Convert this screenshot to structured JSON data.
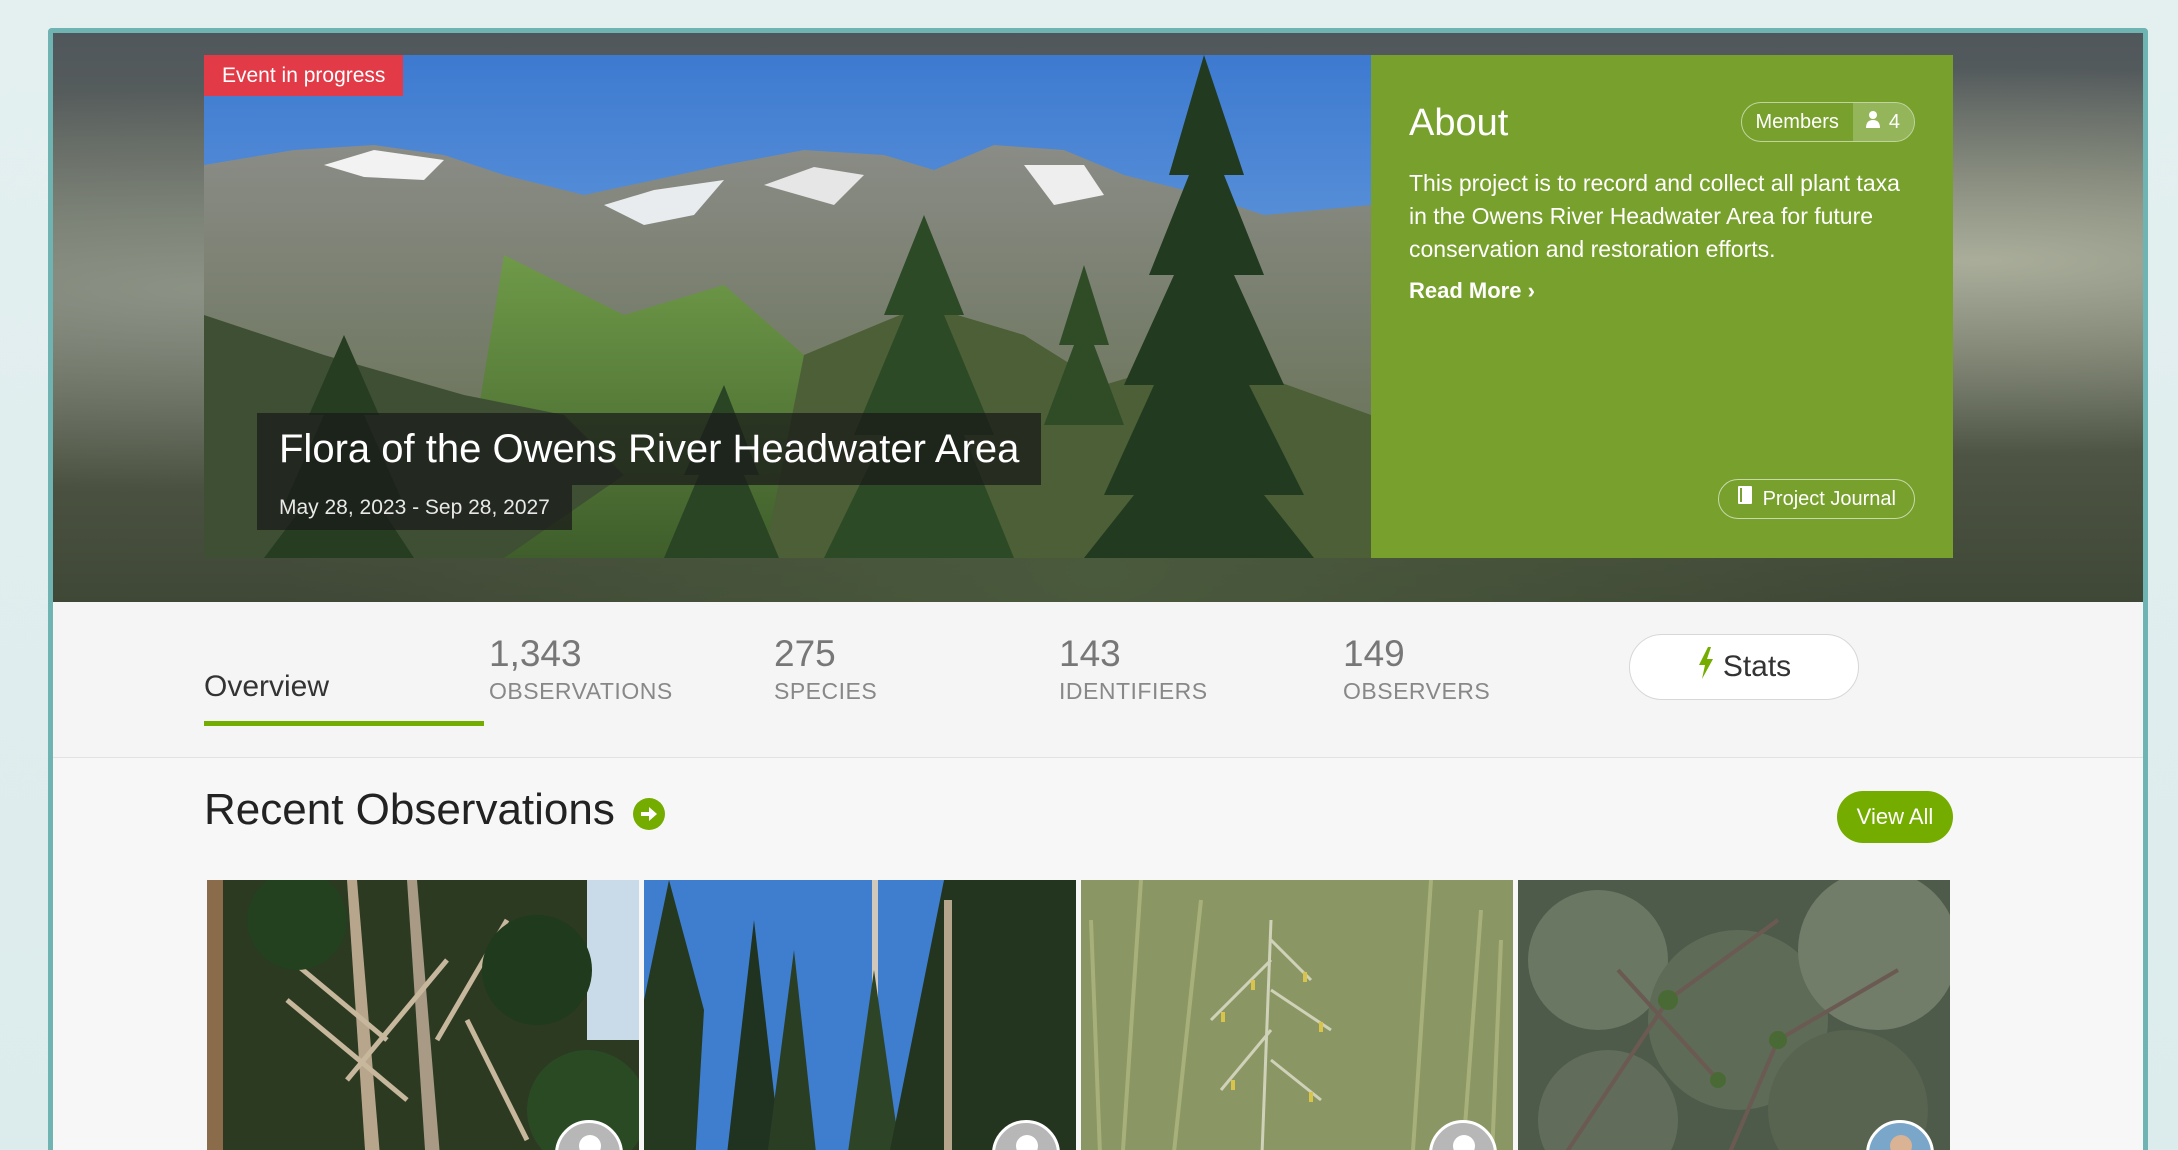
{
  "hero": {
    "badge": "Event in progress",
    "project_title": "Flora of the Owens River Headwater Area",
    "dates": "May 28, 2023 - Sep 28, 2027"
  },
  "about": {
    "title": "About",
    "members_label": "Members",
    "members_count": "4",
    "description": "This project is to record and collect all plant taxa in the Owens River Headwater Area for future conservation and restoration efforts.",
    "read_more": "Read More",
    "journal_label": "Project Journal"
  },
  "tabs": {
    "overview": "Overview",
    "stats": [
      {
        "number": "1,343",
        "label": "OBSERVATIONS"
      },
      {
        "number": "275",
        "label": "SPECIES"
      },
      {
        "number": "143",
        "label": "IDENTIFIERS"
      },
      {
        "number": "149",
        "label": "OBSERVERS"
      }
    ],
    "stats_button": "Stats"
  },
  "recent": {
    "title": "Recent Observations",
    "view_all": "View All"
  },
  "colors": {
    "brand_green": "#74ac00",
    "about_green": "#77a02c",
    "event_red": "#e23b47"
  }
}
